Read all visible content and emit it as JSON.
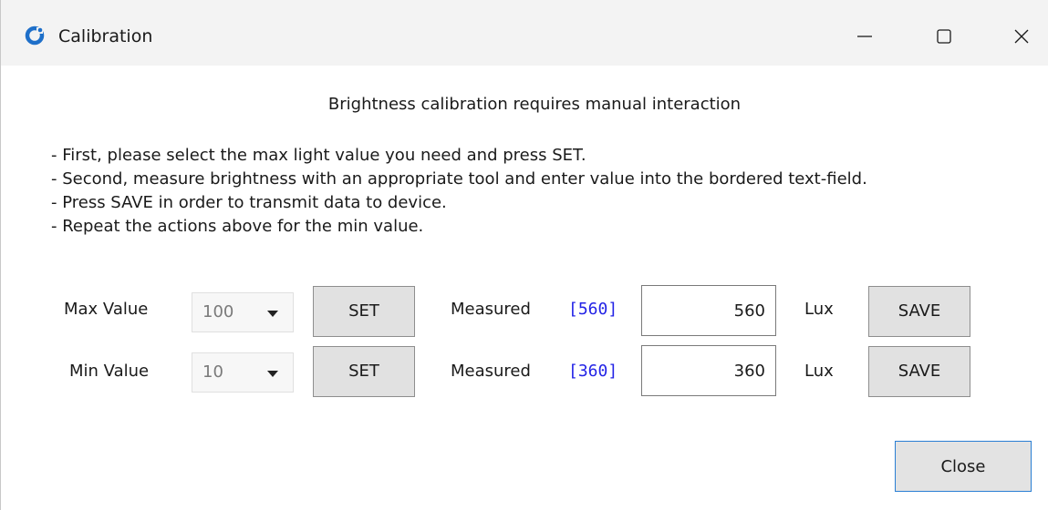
{
  "window": {
    "title": "Calibration",
    "accent_color": "#2a7fd4",
    "icon": "calibration-app-icon"
  },
  "titlebar": {
    "minimize_icon": "minimize-icon",
    "maximize_icon": "maximize-icon",
    "close_icon": "close-icon"
  },
  "heading": "Brightness calibration requires manual interaction",
  "instructions": [
    "- First, please select the max light value you need and press SET.",
    "- Second, measure brightness with an appropriate tool and enter value into the bordered text-field.",
    "- Press SAVE in order to transmit data to device.",
    "- Repeat the actions above for the min value."
  ],
  "rows": {
    "max": {
      "label": "Max Value",
      "selected": "100",
      "set_label": "SET",
      "measured_label": "Measured",
      "measured_readout": "[560]",
      "input_value": "560",
      "unit": "Lux",
      "save_label": "SAVE"
    },
    "min": {
      "label": "Min Value",
      "selected": "10",
      "set_label": "SET",
      "measured_label": "Measured",
      "measured_readout": "[360]",
      "input_value": "360",
      "unit": "Lux",
      "save_label": "SAVE"
    }
  },
  "footer": {
    "close_label": "Close"
  }
}
